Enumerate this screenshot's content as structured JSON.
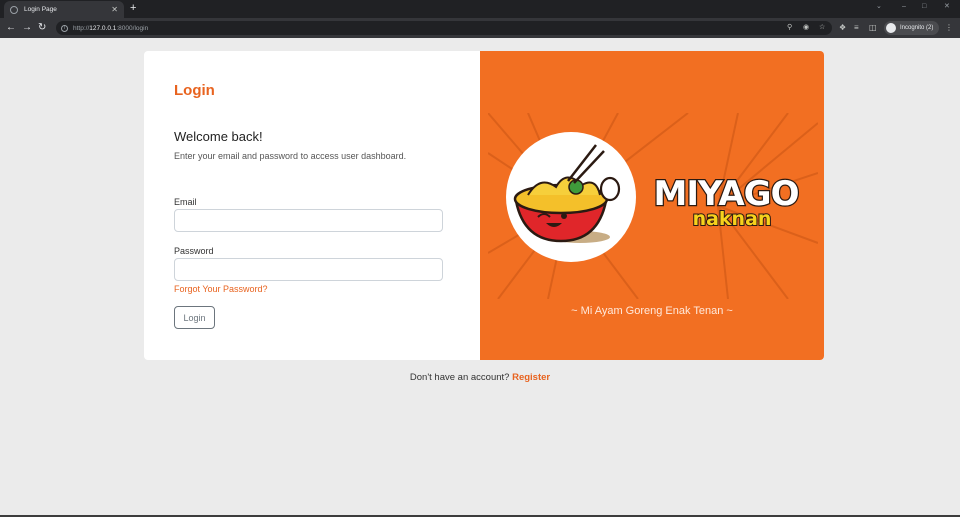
{
  "browser": {
    "tab_title": "Login Page",
    "tab_close": "✕",
    "new_tab": "+",
    "url_prefix": "http://",
    "url_host": "127.0.0.1",
    "url_rest": ":8000/login",
    "incognito_label": "Incognito (2)"
  },
  "login": {
    "heading": "Login",
    "welcome": "Welcome back!",
    "subtitle": "Enter your email and password to access user dashboard.",
    "email_label": "Email",
    "email_value": "",
    "password_label": "Password",
    "password_value": "",
    "forgot_link": "Forgot Your Password?",
    "submit_label": "Login"
  },
  "brand": {
    "logo_text_1": "MIYAGO",
    "logo_text_2": "naknan",
    "tagline": "~ Mi Ayam Goreng Enak Tenan ~",
    "accent_color": "#f26f22"
  },
  "footer": {
    "prompt": "Don't have an account?",
    "register_link": "Register"
  }
}
